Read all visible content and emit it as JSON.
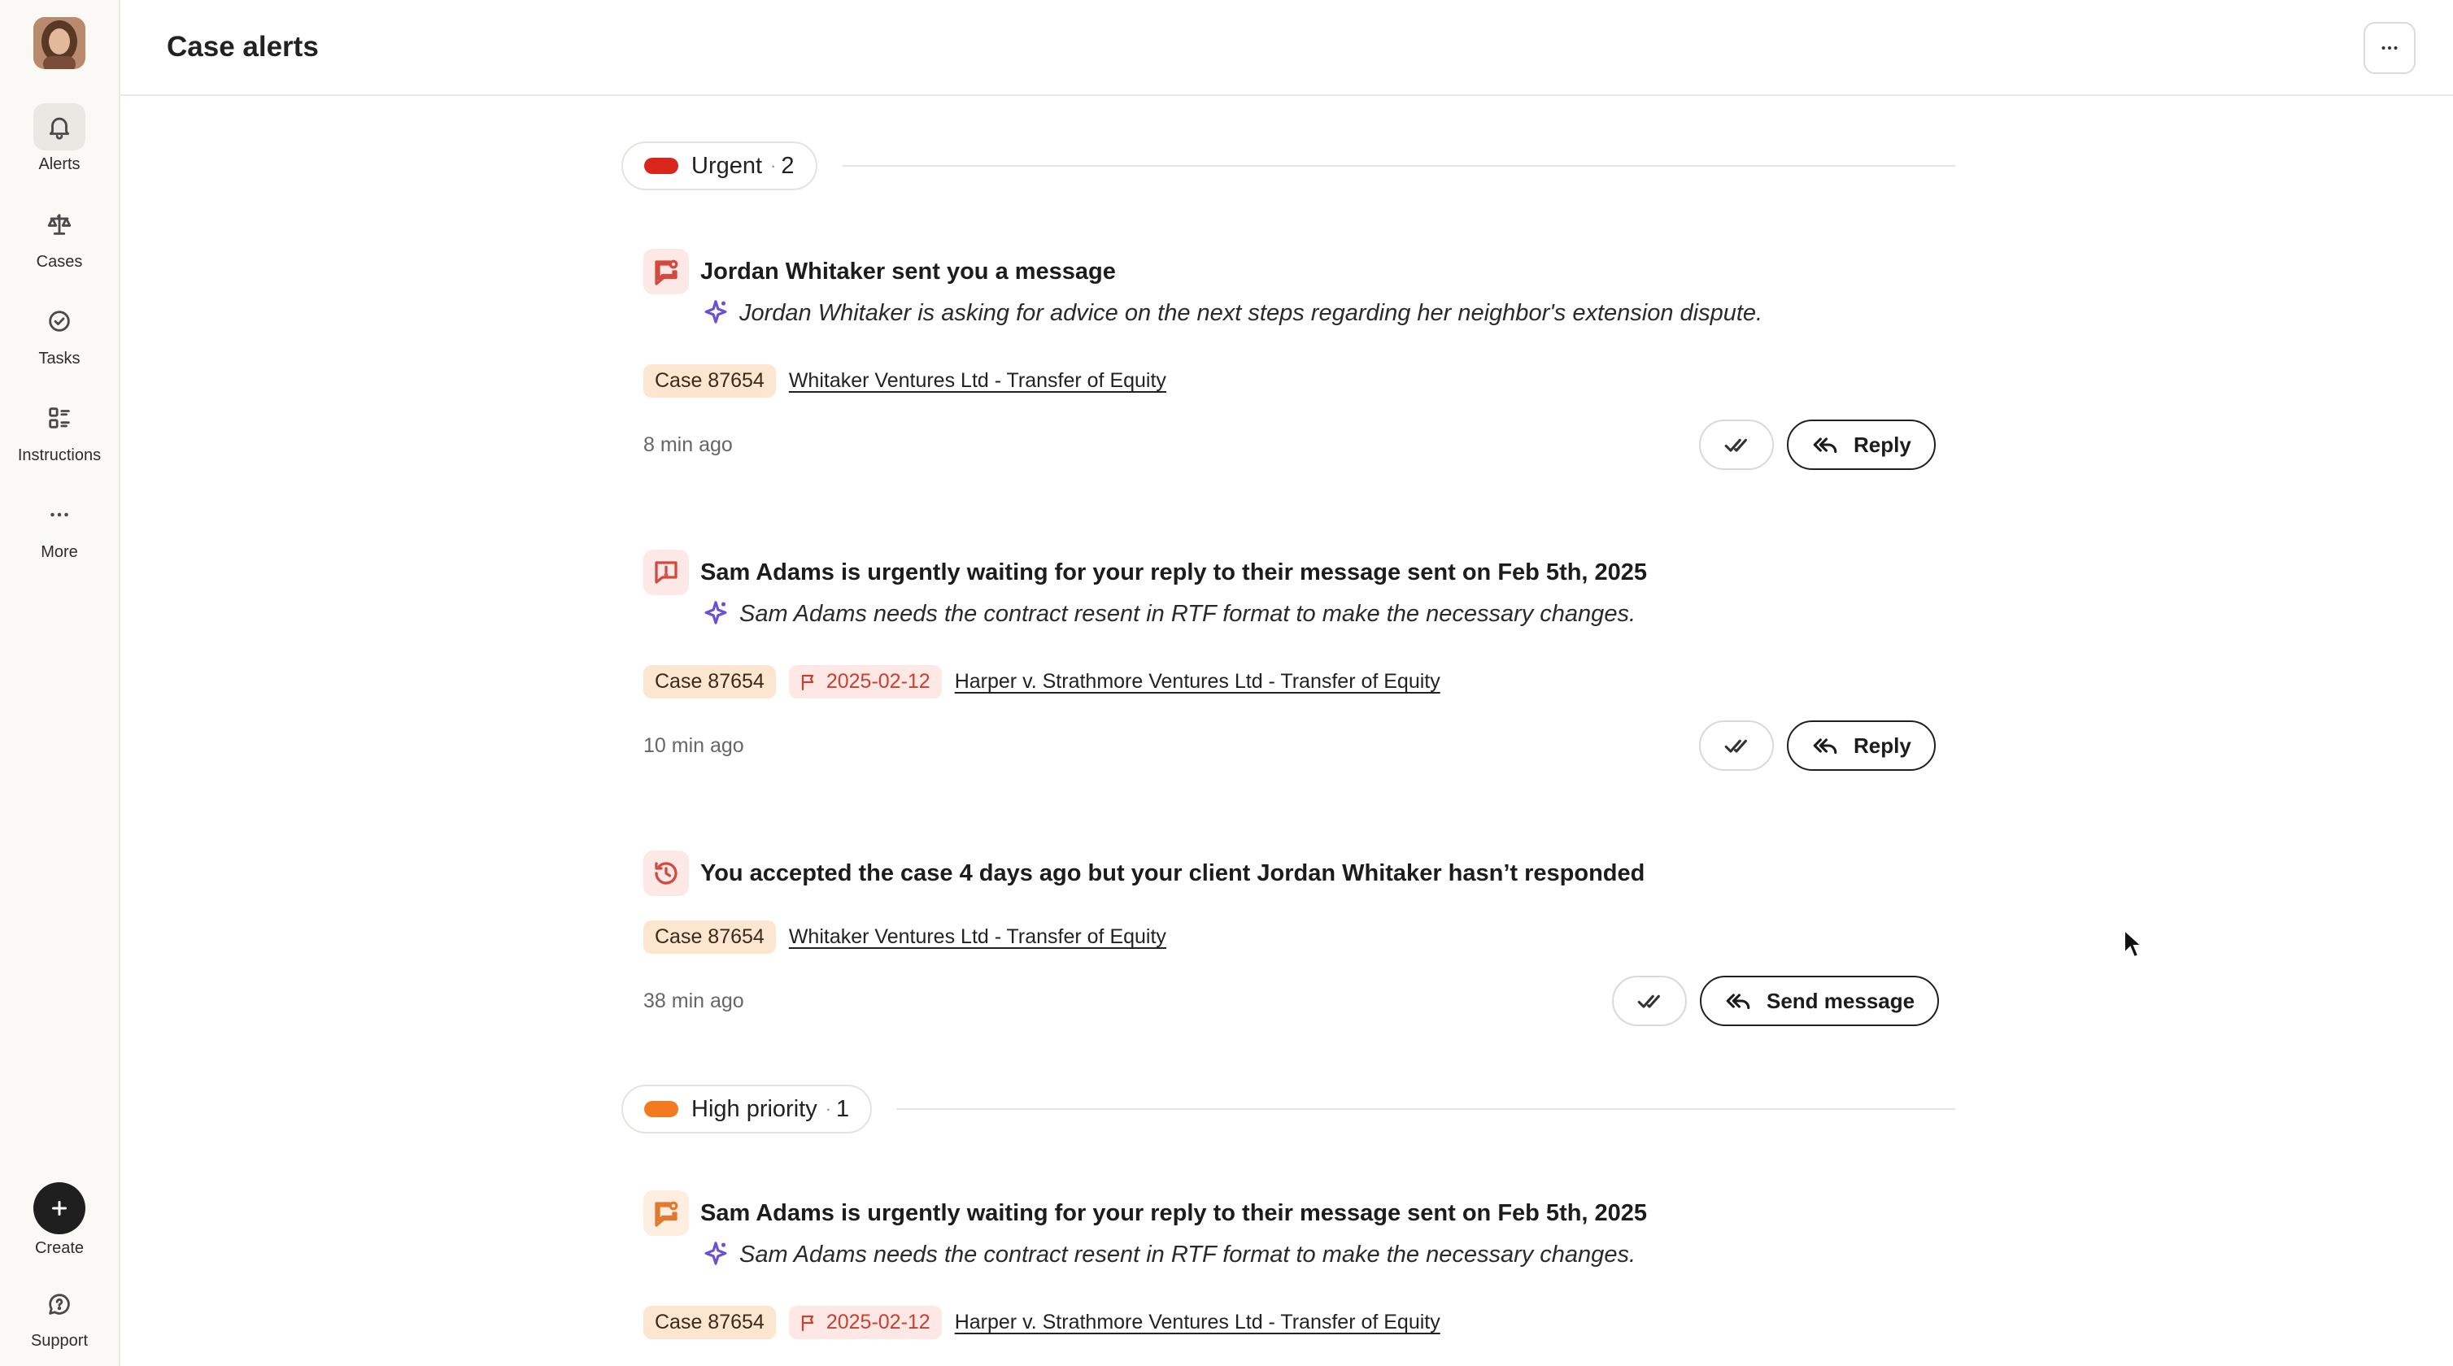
{
  "sidebar": {
    "items": [
      {
        "label": "Alerts",
        "icon": "bell-icon",
        "active": true
      },
      {
        "label": "Cases",
        "icon": "scales-icon"
      },
      {
        "label": "Tasks",
        "icon": "check-circle-icon"
      },
      {
        "label": "Instructions",
        "icon": "grid-list-icon"
      },
      {
        "label": "More",
        "icon": "ellipsis-icon"
      }
    ],
    "create_label": "Create",
    "support_label": "Support"
  },
  "header": {
    "title": "Case alerts"
  },
  "groups": {
    "urgent": {
      "label": "Urgent",
      "count": "2",
      "color": "#d8261d"
    },
    "high": {
      "label": "High priority",
      "count": "1",
      "color": "#f47a20"
    }
  },
  "alerts": [
    {
      "title": "Jordan Whitaker sent you a message",
      "summary": "Jordan Whitaker is asking for advice on the next steps regarding her neighbor's extension dispute.",
      "case": "Case 87654",
      "link": "Whitaker Ventures Ltd - Transfer of Equity",
      "time": "8 min ago",
      "action": "Reply"
    },
    {
      "title": "Sam Adams is urgently waiting for your reply to their message sent on Feb 5th, 2025",
      "summary": "Sam Adams needs the contract resent in RTF format to make the necessary changes.",
      "case": "Case 87654",
      "date": "2025-02-12",
      "link": "Harper v. Strathmore Ventures Ltd - Transfer of Equity",
      "time": "10 min ago",
      "action": "Reply"
    },
    {
      "title": "You accepted the case 4 days ago but your client Jordan Whitaker hasn’t responded",
      "case": "Case 87654",
      "link": "Whitaker Ventures Ltd - Transfer of Equity",
      "time": "38 min ago",
      "action": "Send message"
    },
    {
      "title": "Sam Adams is urgently waiting for your reply to their message sent on Feb 5th, 2025",
      "summary": "Sam Adams needs the contract resent in RTF format to make the necessary changes.",
      "case": "Case 87654",
      "date": "2025-02-12",
      "link": "Harper v. Strathmore Ventures Ltd - Transfer of Equity"
    }
  ]
}
